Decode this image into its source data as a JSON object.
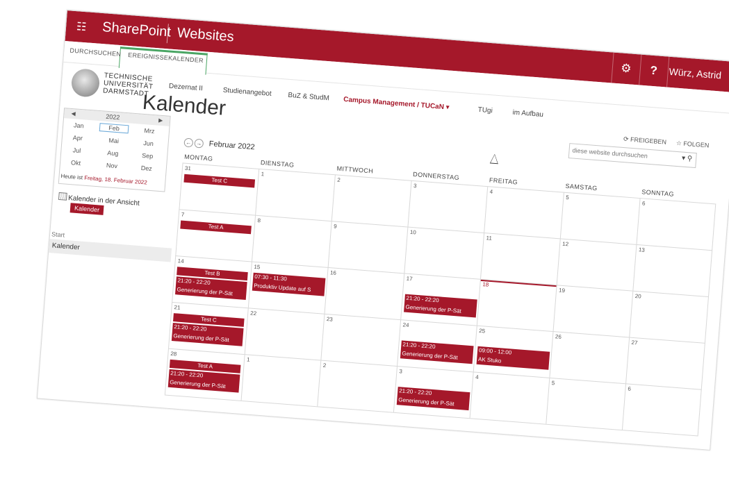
{
  "suitebar": {
    "app_name": "SharePoint",
    "sites_label": "Websites",
    "settings_icon": "gear-icon",
    "help_label": "?",
    "user_name": "Würz, Astrid",
    "color": "#a5182a"
  },
  "ribbon": {
    "tabs": [
      "DURCHSUCHEN",
      "EREIGNISSE",
      "KALENDER"
    ]
  },
  "header": {
    "logo_text": [
      "TECHNISCHE",
      "UNIVERSITÄT",
      "DARMSTADT"
    ],
    "nav": [
      "Dezernat II",
      "Studienangebot",
      "BuZ & StudM",
      "Campus Management / TUCaN",
      "TUgi",
      "im Aufbau"
    ],
    "active_nav": "Campus Management / TUCaN",
    "page_title": "Kalender",
    "share_label": "FREIGEBEN",
    "follow_label": "FOLGEN",
    "search_placeholder": "diese website durchsuchen"
  },
  "datepicker": {
    "year": "2022",
    "months": [
      "Jan",
      "Feb",
      "Mrz",
      "Apr",
      "Mai",
      "Jun",
      "Jul",
      "Aug",
      "Sep",
      "Okt",
      "Nov",
      "Dez"
    ],
    "selected": "Feb",
    "today_prefix": "Heute ist ",
    "today_link": "Freitag, 18. Februar 2022"
  },
  "sidebar": {
    "calendars_in_view": "Kalender in der Ansicht",
    "calendar_chip": "Kalender",
    "quicknav": [
      "Start",
      "Kalender"
    ]
  },
  "calendar": {
    "month_label": "Februar 2022",
    "day_headers": [
      "MONTAG",
      "DIENSTAG",
      "MITTWOCH",
      "DONNERSTAG",
      "FREITAG",
      "SAMSTAG",
      "SONNTAG"
    ],
    "weeks": [
      [
        "31",
        "1",
        "2",
        "3",
        "4",
        "5",
        "6"
      ],
      [
        "7",
        "8",
        "9",
        "10",
        "11",
        "12",
        "13"
      ],
      [
        "14",
        "15",
        "16",
        "17",
        "18",
        "19",
        "20"
      ],
      [
        "21",
        "22",
        "23",
        "24",
        "25",
        "26",
        "27"
      ],
      [
        "28",
        "1",
        "2",
        "3",
        "4",
        "5",
        "6"
      ]
    ],
    "today": "18",
    "events": {
      "w0_mon": "Test C",
      "w1_mon": "Test A",
      "w2_mon_title": "Test B",
      "w2_mon_time": "21:20 - 22:20",
      "w2_mon_desc": "Generierung der P-Sät",
      "w2_tue_time": "07:30 - 11:30",
      "w2_tue_desc": "Produktiv Update auf S",
      "w2_thu_time": "21:20 - 22:20",
      "w2_thu_desc": "Generierung der P-Sät",
      "w3_mon_title": "Test C",
      "w3_mon_time": "21:20 - 22:20",
      "w3_mon_desc": "Generierung der P-Sät",
      "w3_thu_time": "21:20 - 22:20",
      "w3_thu_desc": "Generierung der P-Sät",
      "w3_fri_time": "09:00 - 12:00",
      "w3_fri_desc": "AK Stuko",
      "w4_mon_title": "Test A",
      "w4_mon_time": "21:20 - 22:20",
      "w4_mon_desc": "Generierung der P-Sät",
      "w4_thu_time": "21:20 - 22:20",
      "w4_thu_desc": "Generierung der P-Sät"
    }
  }
}
